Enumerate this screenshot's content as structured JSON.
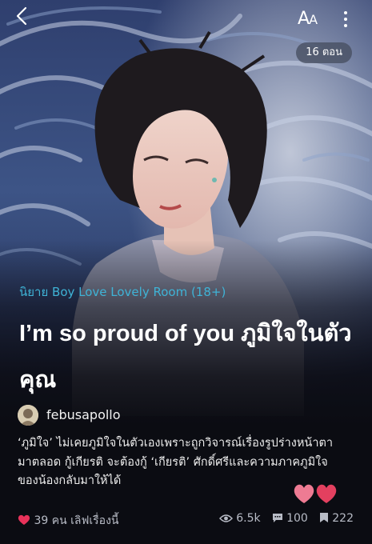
{
  "header": {
    "back_icon": "chevron-left-icon",
    "font_size_label_big": "A",
    "font_size_label_small": "A",
    "more_icon": "more-vertical-icon",
    "episodes_badge": "16 ตอน"
  },
  "story": {
    "genre_tag": "นิยาย Boy Love Lovely Room (18+)",
    "title": "I’m so proud of you ภูมิใจในตัวคุณ",
    "author": "febusapollo",
    "synopsis": "‘ภูมิใจ’ ไม่เคยภูมิใจในตัวเองเพราะถูกวิจารณ์เรื่องรูปร่างหน้าตามาตลอด กู้เกียรติ จะต้องกู้ ‘เกียรติ’ ศักดิ์ศรีและความภาคภูมิใจของน้องกลับมาให้ได้"
  },
  "stats": {
    "likes_label": "39 คน เลิฟเรื่องนี้",
    "views": "6.5k",
    "comments": "100",
    "bookmarks": "222"
  },
  "colors": {
    "accent_blue": "#3fb3d6",
    "heart_pink": "#e8325a",
    "badge_bg": "#464e60"
  }
}
